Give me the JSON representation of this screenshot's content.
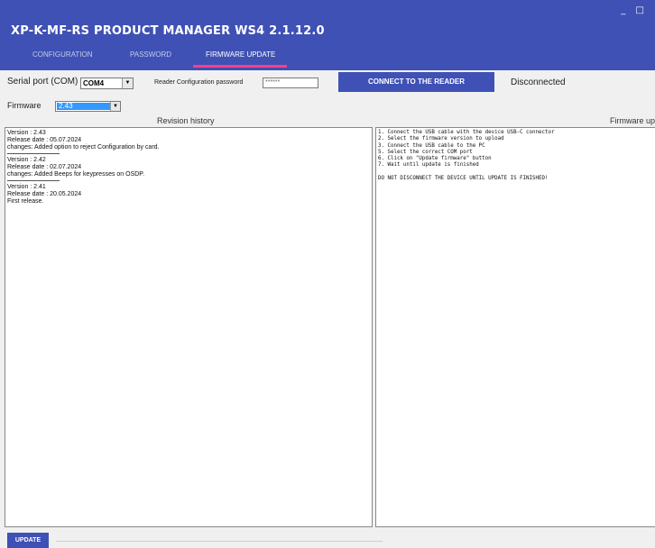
{
  "window": {
    "controls": "_ □"
  },
  "app": {
    "title": "XP-K-MF-RS  PRODUCT MANAGER WS4 2.1.12.0"
  },
  "tabs": [
    {
      "label": "CONFIGURATION"
    },
    {
      "label": "PASSWORD"
    },
    {
      "label": "FIRMWARE UPDATE",
      "active": true
    }
  ],
  "serial": {
    "label": "Serial port (COM)",
    "port": "COM4",
    "password_label": "Reader Configuration password",
    "password_value": "******",
    "connect_label": "CONNECT TO THE READER",
    "status": "Disconnected"
  },
  "firmware": {
    "label": "Firmware",
    "selected": "2.43",
    "revision_header": "Revision history",
    "instructions_header": "Firmware up"
  },
  "revisions": [
    {
      "version": "Version : 2.43",
      "date": "Release date : 05.07.2024",
      "changes": "changes: Added option to reject Configuration by card."
    },
    {
      "version": "Version : 2.42",
      "date": "Release date : 02.07.2024",
      "changes": "changes: Added Beeps for keypresses on OSDP."
    },
    {
      "version": "Version : 2.41",
      "date": "Release date : 20.05.2024",
      "changes": "First release."
    }
  ],
  "instructions": [
    "1. Connect the USB cable with the device USB-C connector",
    "2. Select the firmware version to upload",
    "3. Connect the USB cable to the PC",
    "5. Select the correct COM port",
    "6. Click on \"Update firmware\" button",
    "7. Wait until update is finished",
    "",
    "DO NOT DISCONNECT THE DEVICE UNTIL UPDATE IS FINISHED!"
  ],
  "actions": {
    "update_label": "UPDATE",
    "progress": 0
  },
  "colors": {
    "primary": "#3f51b5",
    "accent": "#ff4081",
    "selection": "#3399ff"
  }
}
